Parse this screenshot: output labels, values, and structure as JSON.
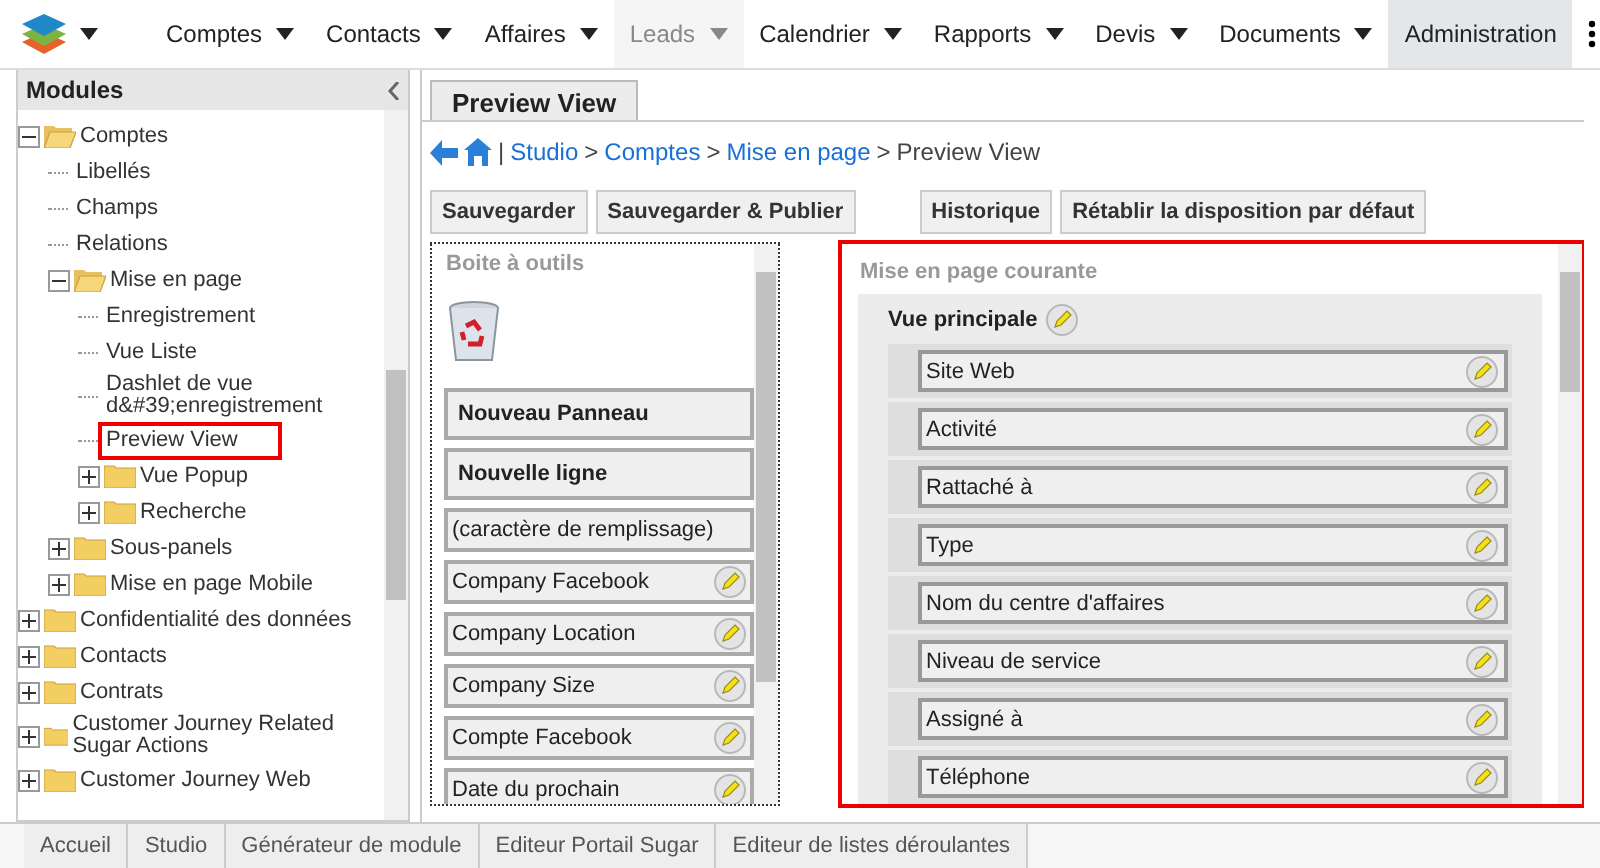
{
  "nav": {
    "items": [
      {
        "label": "Comptes",
        "has_menu": true,
        "selected": false,
        "disabled": false
      },
      {
        "label": "Contacts",
        "has_menu": true,
        "selected": false,
        "disabled": false
      },
      {
        "label": "Affaires",
        "has_menu": true,
        "selected": false,
        "disabled": false
      },
      {
        "label": "Leads",
        "has_menu": true,
        "selected": false,
        "disabled": true
      },
      {
        "label": "Calendrier",
        "has_menu": true,
        "selected": false,
        "disabled": false
      },
      {
        "label": "Rapports",
        "has_menu": true,
        "selected": false,
        "disabled": false
      },
      {
        "label": "Devis",
        "has_menu": true,
        "selected": false,
        "disabled": false
      },
      {
        "label": "Documents",
        "has_menu": true,
        "selected": false,
        "disabled": false
      },
      {
        "label": "Administration",
        "has_menu": false,
        "selected": true,
        "disabled": false
      }
    ]
  },
  "sidebar": {
    "title": "Modules",
    "tree": [
      {
        "label": "Comptes",
        "kind": "folder",
        "expanded": true,
        "children": [
          {
            "label": "Libellés",
            "kind": "leaf",
            "selected": false
          },
          {
            "label": "Champs",
            "kind": "leaf",
            "selected": false
          },
          {
            "label": "Relations",
            "kind": "leaf",
            "selected": false
          },
          {
            "label": "Mise en page",
            "kind": "folder",
            "expanded": true,
            "children": [
              {
                "label": "Enregistrement",
                "kind": "leaf",
                "selected": false
              },
              {
                "label": "Vue Liste",
                "kind": "leaf",
                "selected": false
              },
              {
                "label": "Dashlet de vue d&#39;enregistrement",
                "kind": "leaf",
                "selected": false
              },
              {
                "label": "Preview View",
                "kind": "leaf",
                "selected": true
              },
              {
                "label": "Vue Popup",
                "kind": "folder",
                "expanded": false
              },
              {
                "label": "Recherche",
                "kind": "folder",
                "expanded": false
              }
            ]
          },
          {
            "label": "Sous-panels",
            "kind": "folder",
            "expanded": false
          },
          {
            "label": "Mise en page Mobile",
            "kind": "folder",
            "expanded": false
          }
        ]
      },
      {
        "label": "Confidentialité des données",
        "kind": "folder",
        "expanded": false
      },
      {
        "label": "Contacts",
        "kind": "folder",
        "expanded": false
      },
      {
        "label": "Contrats",
        "kind": "folder",
        "expanded": false
      },
      {
        "label": "Customer Journey Related Sugar Actions",
        "kind": "folder",
        "expanded": false
      },
      {
        "label": "Customer Journey Web",
        "kind": "folder",
        "expanded": false
      }
    ]
  },
  "content": {
    "tab": "Preview View",
    "breadcrumb": {
      "separator": "|",
      "arrow": ">",
      "links": [
        "Studio",
        "Comptes",
        "Mise en page"
      ],
      "current": "Preview View"
    },
    "button_groups": [
      [
        "Sauvegarder",
        "Sauvegarder & Publier"
      ],
      [
        "Historique",
        "Rétablir la disposition par défaut"
      ]
    ],
    "toolbox": {
      "title": "Boite à outils",
      "items": [
        {
          "label": "Nouveau Panneau",
          "kind": "panel"
        },
        {
          "label": "Nouvelle ligne",
          "kind": "row"
        },
        {
          "label": "(caractère de remplissage)",
          "kind": "filler"
        },
        {
          "label": "Company Facebook",
          "kind": "field"
        },
        {
          "label": "Company Location",
          "kind": "field"
        },
        {
          "label": "Company Size",
          "kind": "field"
        },
        {
          "label": "Compte Facebook",
          "kind": "field"
        },
        {
          "label": "Date du prochain",
          "kind": "field"
        }
      ]
    },
    "layout": {
      "title": "Mise en page courante",
      "highlighted": true,
      "panel": "Vue principale",
      "fields": [
        "Site Web",
        "Activité",
        "Rattaché à",
        "Type",
        "Nom du centre d'affaires",
        "Niveau de service",
        "Assigné à",
        "Téléphone"
      ]
    }
  },
  "bottom_tabs": [
    "Accueil",
    "Studio",
    "Générateur de module",
    "Editeur Portail Sugar",
    "Editeur de listes déroulantes"
  ]
}
